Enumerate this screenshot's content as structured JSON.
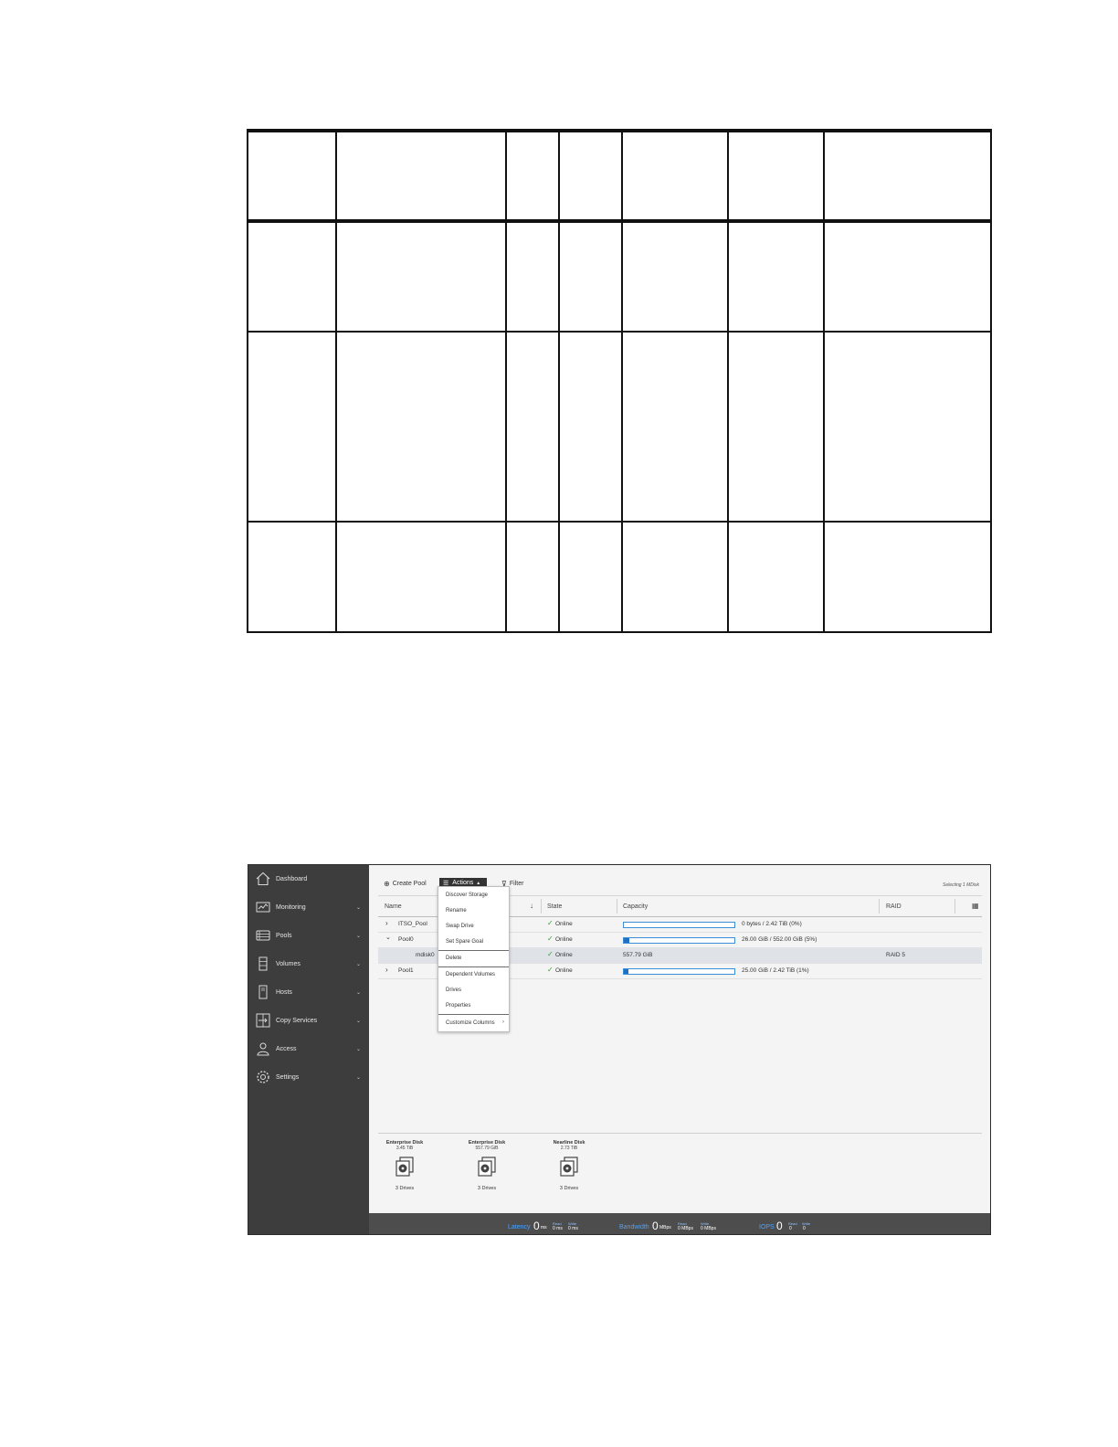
{
  "sidebar": {
    "items": [
      {
        "label": "Dashboard",
        "icon": "home-icon",
        "chevron": false
      },
      {
        "label": "Monitoring",
        "icon": "monitoring-icon",
        "chevron": true
      },
      {
        "label": "Pools",
        "icon": "pools-icon",
        "chevron": true
      },
      {
        "label": "Volumes",
        "icon": "volumes-icon",
        "chevron": true
      },
      {
        "label": "Hosts",
        "icon": "hosts-icon",
        "chevron": true
      },
      {
        "label": "Copy Services",
        "icon": "copy-services-icon",
        "chevron": true
      },
      {
        "label": "Access",
        "icon": "access-icon",
        "chevron": true
      },
      {
        "label": "Settings",
        "icon": "settings-icon",
        "chevron": true
      }
    ],
    "chevron_glyph": "⌄"
  },
  "toolbar": {
    "create_pool": "Create Pool",
    "actions": "Actions",
    "filter": "Filter",
    "selecting": "Selecting 1 MDisk"
  },
  "grid": {
    "columns": [
      "Name",
      "State",
      "Capacity",
      "RAID"
    ],
    "rows": [
      {
        "name": "ITSO_Pool",
        "state": "Online",
        "capacity_text": "0 bytes / 2.42 TiB (0%)",
        "raid": "",
        "usage": 0.0
      },
      {
        "name": "Pool0",
        "state": "Online",
        "capacity_text": "26.00 GiB / 552.00 GiB (5%)",
        "raid": "",
        "usage": 0.05
      },
      {
        "name": "mdisk0",
        "state": "Online",
        "capacity_text": "557.79 GiB",
        "raid": "RAID 5"
      },
      {
        "name": "Pool1",
        "state": "Online",
        "capacity_text": "25.00 GiB / 2.42 TiB (1%)",
        "raid": "",
        "usage": 0.01
      }
    ]
  },
  "actions_menu": {
    "items": [
      "Discover Storage",
      "Rename",
      "Swap Drive",
      "Set Spare Goal",
      "Delete",
      "Dependent Volumes",
      "Drives",
      "Properties",
      "Customize Columns"
    ]
  },
  "tiers": [
    {
      "name": "Enterprise Disk",
      "capacity": "3.45 TiB",
      "drives": "3 Drives"
    },
    {
      "name": "Enterprise Disk",
      "capacity": "557.79 GiB",
      "drives": "3 Drives"
    },
    {
      "name": "Nearline Disk",
      "capacity": "2.73 TiB",
      "drives": "3 Drives"
    }
  ],
  "status": {
    "latency": {
      "label": "Latency",
      "value": "0",
      "unit": "ms",
      "read_label": "Read",
      "write_label": "Write",
      "read": "0 ms",
      "write": "0 ms"
    },
    "bandwidth": {
      "label": "Bandwidth",
      "value": "0",
      "unit": "MBps",
      "read_label": "Read",
      "write_label": "Write",
      "read": "0 MBps",
      "write": "0 MBps"
    },
    "iops": {
      "label": "IOPS",
      "value": "0",
      "read_label": "Read",
      "write_label": "Write",
      "read": "0",
      "write": "0"
    }
  },
  "colors": {
    "accent": "#1f70c1",
    "online": "#3a9a3a",
    "sidebar": "#3d3d3d",
    "status_label": "#4aa3ff"
  }
}
